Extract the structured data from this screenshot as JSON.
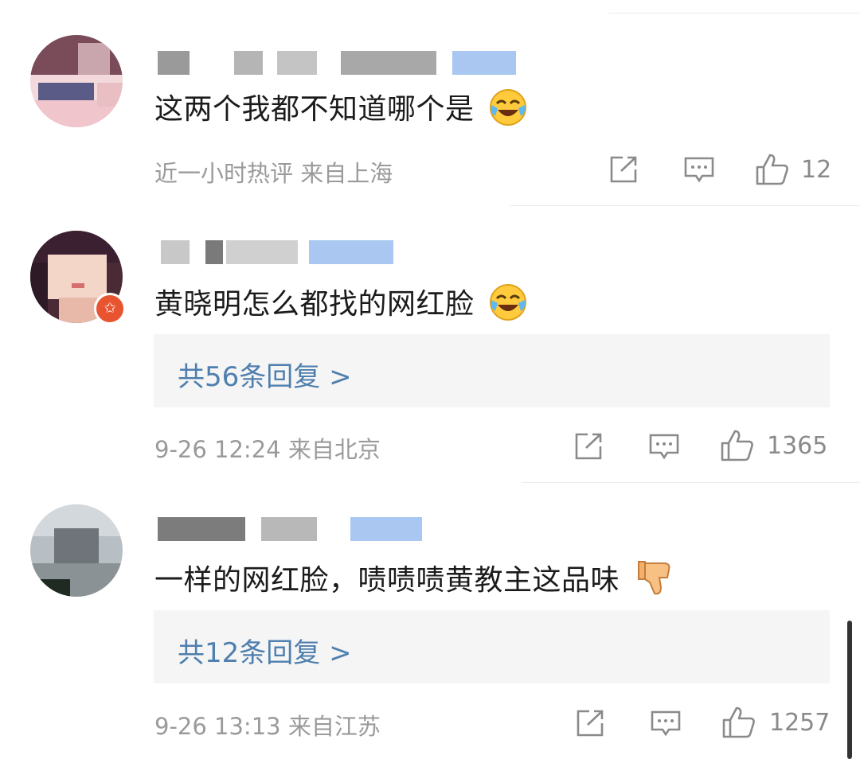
{
  "comments": [
    {
      "content": "这两个我都不知道哪个是",
      "emoji_icon": "tears-of-joy-emoji",
      "meta": "近一小时热评  来自上海",
      "likes": "12",
      "reply_link": null
    },
    {
      "content": "黄晓明怎么都找的网红脸",
      "emoji_icon": "tears-of-joy-emoji",
      "meta": "9-26 12:24  来自北京",
      "likes": "1365",
      "reply_link": "共56条回复 >"
    },
    {
      "content": "一样的网红脸，啧啧啧黄教主这品味",
      "emoji_icon": "thumbs-down-emoji",
      "meta": "9-26 13:13  来自江苏",
      "likes": "1257",
      "reply_link": "共12条回复 >"
    }
  ],
  "colors": {
    "link": "#4e7fae",
    "meta": "#9a9a9a",
    "reply_bg": "#f5f5f5",
    "badge": "#e8542f"
  },
  "icons": [
    "share-icon",
    "comment-icon",
    "like-icon"
  ]
}
